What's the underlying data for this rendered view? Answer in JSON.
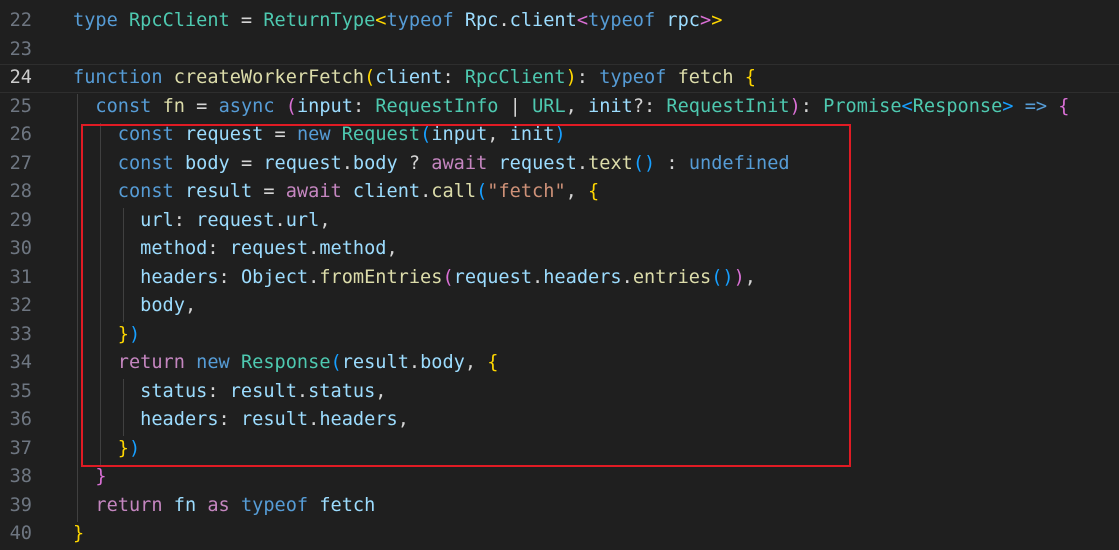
{
  "editor": {
    "colors": {
      "background": "#1f1f1f",
      "highlight_box": "#e01b24"
    },
    "lines": [
      {
        "number": "22",
        "current": false,
        "tokens": [
          {
            "t": "type",
            "c": "kw"
          },
          {
            "t": " ",
            "c": "pl"
          },
          {
            "t": "RpcClient",
            "c": "ty"
          },
          {
            "t": " = ",
            "c": "op"
          },
          {
            "t": "ReturnType",
            "c": "ty"
          },
          {
            "t": "<",
            "c": "b1"
          },
          {
            "t": "typeof",
            "c": "kw"
          },
          {
            "t": " ",
            "c": "pl"
          },
          {
            "t": "Rpc",
            "c": "var"
          },
          {
            "t": ".",
            "c": "pl"
          },
          {
            "t": "client",
            "c": "var"
          },
          {
            "t": "<",
            "c": "b2"
          },
          {
            "t": "typeof",
            "c": "kw"
          },
          {
            "t": " ",
            "c": "pl"
          },
          {
            "t": "rpc",
            "c": "var"
          },
          {
            "t": ">",
            "c": "b2"
          },
          {
            "t": ">",
            "c": "b1"
          }
        ]
      },
      {
        "number": "23",
        "current": false,
        "tokens": []
      },
      {
        "number": "24",
        "current": true,
        "tokens": [
          {
            "t": "function",
            "c": "kw"
          },
          {
            "t": " ",
            "c": "pl"
          },
          {
            "t": "createWorkerFetch",
            "c": "fn"
          },
          {
            "t": "(",
            "c": "b1"
          },
          {
            "t": "client",
            "c": "var"
          },
          {
            "t": ": ",
            "c": "pl"
          },
          {
            "t": "RpcClient",
            "c": "ty"
          },
          {
            "t": ")",
            "c": "b1"
          },
          {
            "t": ": ",
            "c": "pl"
          },
          {
            "t": "typeof",
            "c": "kw"
          },
          {
            "t": " ",
            "c": "pl"
          },
          {
            "t": "fetch",
            "c": "fn"
          },
          {
            "t": " ",
            "c": "pl"
          },
          {
            "t": "{",
            "c": "b1"
          }
        ]
      },
      {
        "number": "25",
        "current": false,
        "tokens": [
          {
            "t": "  ",
            "c": "pl"
          },
          {
            "t": "const",
            "c": "kw"
          },
          {
            "t": " ",
            "c": "pl"
          },
          {
            "t": "fn",
            "c": "fn"
          },
          {
            "t": " = ",
            "c": "op"
          },
          {
            "t": "async",
            "c": "kw"
          },
          {
            "t": " ",
            "c": "pl"
          },
          {
            "t": "(",
            "c": "b2"
          },
          {
            "t": "input",
            "c": "var"
          },
          {
            "t": ": ",
            "c": "pl"
          },
          {
            "t": "RequestInfo",
            "c": "ty"
          },
          {
            "t": " | ",
            "c": "op"
          },
          {
            "t": "URL",
            "c": "ty"
          },
          {
            "t": ", ",
            "c": "pl"
          },
          {
            "t": "init",
            "c": "var"
          },
          {
            "t": "?: ",
            "c": "pl"
          },
          {
            "t": "RequestInit",
            "c": "ty"
          },
          {
            "t": ")",
            "c": "b2"
          },
          {
            "t": ": ",
            "c": "pl"
          },
          {
            "t": "Promise",
            "c": "ty"
          },
          {
            "t": "<",
            "c": "b3"
          },
          {
            "t": "Response",
            "c": "ty"
          },
          {
            "t": ">",
            "c": "b3"
          },
          {
            "t": " ",
            "c": "pl"
          },
          {
            "t": "=>",
            "c": "kw"
          },
          {
            "t": " ",
            "c": "pl"
          },
          {
            "t": "{",
            "c": "b2"
          }
        ]
      },
      {
        "number": "26",
        "current": false,
        "tokens": [
          {
            "t": "    ",
            "c": "pl"
          },
          {
            "t": "const",
            "c": "kw"
          },
          {
            "t": " ",
            "c": "pl"
          },
          {
            "t": "request",
            "c": "var"
          },
          {
            "t": " = ",
            "c": "op"
          },
          {
            "t": "new",
            "c": "kw"
          },
          {
            "t": " ",
            "c": "pl"
          },
          {
            "t": "Request",
            "c": "ty"
          },
          {
            "t": "(",
            "c": "b3"
          },
          {
            "t": "input",
            "c": "var"
          },
          {
            "t": ", ",
            "c": "pl"
          },
          {
            "t": "init",
            "c": "var"
          },
          {
            "t": ")",
            "c": "b3"
          }
        ]
      },
      {
        "number": "27",
        "current": false,
        "tokens": [
          {
            "t": "    ",
            "c": "pl"
          },
          {
            "t": "const",
            "c": "kw"
          },
          {
            "t": " ",
            "c": "pl"
          },
          {
            "t": "body",
            "c": "var"
          },
          {
            "t": " = ",
            "c": "op"
          },
          {
            "t": "request",
            "c": "var"
          },
          {
            "t": ".",
            "c": "pl"
          },
          {
            "t": "body",
            "c": "var"
          },
          {
            "t": " ? ",
            "c": "op"
          },
          {
            "t": "await",
            "c": "ctl"
          },
          {
            "t": " ",
            "c": "pl"
          },
          {
            "t": "request",
            "c": "var"
          },
          {
            "t": ".",
            "c": "pl"
          },
          {
            "t": "text",
            "c": "fn"
          },
          {
            "t": "()",
            "c": "b3"
          },
          {
            "t": " : ",
            "c": "op"
          },
          {
            "t": "undefined",
            "c": "kw"
          }
        ]
      },
      {
        "number": "28",
        "current": false,
        "tokens": [
          {
            "t": "    ",
            "c": "pl"
          },
          {
            "t": "const",
            "c": "kw"
          },
          {
            "t": " ",
            "c": "pl"
          },
          {
            "t": "result",
            "c": "var"
          },
          {
            "t": " = ",
            "c": "op"
          },
          {
            "t": "await",
            "c": "ctl"
          },
          {
            "t": " ",
            "c": "pl"
          },
          {
            "t": "client",
            "c": "var"
          },
          {
            "t": ".",
            "c": "pl"
          },
          {
            "t": "call",
            "c": "fn"
          },
          {
            "t": "(",
            "c": "b3"
          },
          {
            "t": "\"fetch\"",
            "c": "str"
          },
          {
            "t": ", ",
            "c": "pl"
          },
          {
            "t": "{",
            "c": "b1"
          }
        ]
      },
      {
        "number": "29",
        "current": false,
        "tokens": [
          {
            "t": "      ",
            "c": "pl"
          },
          {
            "t": "url",
            "c": "var"
          },
          {
            "t": ": ",
            "c": "pl"
          },
          {
            "t": "request",
            "c": "var"
          },
          {
            "t": ".",
            "c": "pl"
          },
          {
            "t": "url",
            "c": "var"
          },
          {
            "t": ",",
            "c": "pl"
          }
        ]
      },
      {
        "number": "30",
        "current": false,
        "tokens": [
          {
            "t": "      ",
            "c": "pl"
          },
          {
            "t": "method",
            "c": "var"
          },
          {
            "t": ": ",
            "c": "pl"
          },
          {
            "t": "request",
            "c": "var"
          },
          {
            "t": ".",
            "c": "pl"
          },
          {
            "t": "method",
            "c": "var"
          },
          {
            "t": ",",
            "c": "pl"
          }
        ]
      },
      {
        "number": "31",
        "current": false,
        "tokens": [
          {
            "t": "      ",
            "c": "pl"
          },
          {
            "t": "headers",
            "c": "var"
          },
          {
            "t": ": ",
            "c": "pl"
          },
          {
            "t": "Object",
            "c": "var"
          },
          {
            "t": ".",
            "c": "pl"
          },
          {
            "t": "fromEntries",
            "c": "fn"
          },
          {
            "t": "(",
            "c": "b2"
          },
          {
            "t": "request",
            "c": "var"
          },
          {
            "t": ".",
            "c": "pl"
          },
          {
            "t": "headers",
            "c": "var"
          },
          {
            "t": ".",
            "c": "pl"
          },
          {
            "t": "entries",
            "c": "fn"
          },
          {
            "t": "()",
            "c": "b3"
          },
          {
            "t": ")",
            "c": "b2"
          },
          {
            "t": ",",
            "c": "pl"
          }
        ]
      },
      {
        "number": "32",
        "current": false,
        "tokens": [
          {
            "t": "      ",
            "c": "pl"
          },
          {
            "t": "body",
            "c": "var"
          },
          {
            "t": ",",
            "c": "pl"
          }
        ]
      },
      {
        "number": "33",
        "current": false,
        "tokens": [
          {
            "t": "    ",
            "c": "pl"
          },
          {
            "t": "}",
            "c": "b1"
          },
          {
            "t": ")",
            "c": "b3"
          }
        ]
      },
      {
        "number": "34",
        "current": false,
        "tokens": [
          {
            "t": "    ",
            "c": "pl"
          },
          {
            "t": "return",
            "c": "ctl"
          },
          {
            "t": " ",
            "c": "pl"
          },
          {
            "t": "new",
            "c": "kw"
          },
          {
            "t": " ",
            "c": "pl"
          },
          {
            "t": "Response",
            "c": "ty"
          },
          {
            "t": "(",
            "c": "b3"
          },
          {
            "t": "result",
            "c": "var"
          },
          {
            "t": ".",
            "c": "pl"
          },
          {
            "t": "body",
            "c": "var"
          },
          {
            "t": ", ",
            "c": "pl"
          },
          {
            "t": "{",
            "c": "b1"
          }
        ]
      },
      {
        "number": "35",
        "current": false,
        "tokens": [
          {
            "t": "      ",
            "c": "pl"
          },
          {
            "t": "status",
            "c": "var"
          },
          {
            "t": ": ",
            "c": "pl"
          },
          {
            "t": "result",
            "c": "var"
          },
          {
            "t": ".",
            "c": "pl"
          },
          {
            "t": "status",
            "c": "var"
          },
          {
            "t": ",",
            "c": "pl"
          }
        ]
      },
      {
        "number": "36",
        "current": false,
        "tokens": [
          {
            "t": "      ",
            "c": "pl"
          },
          {
            "t": "headers",
            "c": "var"
          },
          {
            "t": ": ",
            "c": "pl"
          },
          {
            "t": "result",
            "c": "var"
          },
          {
            "t": ".",
            "c": "pl"
          },
          {
            "t": "headers",
            "c": "var"
          },
          {
            "t": ",",
            "c": "pl"
          }
        ]
      },
      {
        "number": "37",
        "current": false,
        "tokens": [
          {
            "t": "    ",
            "c": "pl"
          },
          {
            "t": "}",
            "c": "b1"
          },
          {
            "t": ")",
            "c": "b3"
          }
        ]
      },
      {
        "number": "38",
        "current": false,
        "tokens": [
          {
            "t": "  ",
            "c": "pl"
          },
          {
            "t": "}",
            "c": "b2"
          }
        ]
      },
      {
        "number": "39",
        "current": false,
        "tokens": [
          {
            "t": "  ",
            "c": "pl"
          },
          {
            "t": "return",
            "c": "ctl"
          },
          {
            "t": " ",
            "c": "pl"
          },
          {
            "t": "fn",
            "c": "var"
          },
          {
            "t": " ",
            "c": "pl"
          },
          {
            "t": "as",
            "c": "ctl"
          },
          {
            "t": " ",
            "c": "pl"
          },
          {
            "t": "typeof",
            "c": "kw"
          },
          {
            "t": " ",
            "c": "pl"
          },
          {
            "t": "fetch",
            "c": "var"
          }
        ]
      },
      {
        "number": "40",
        "current": false,
        "tokens": [
          {
            "t": "}",
            "c": "b1"
          }
        ]
      }
    ]
  }
}
